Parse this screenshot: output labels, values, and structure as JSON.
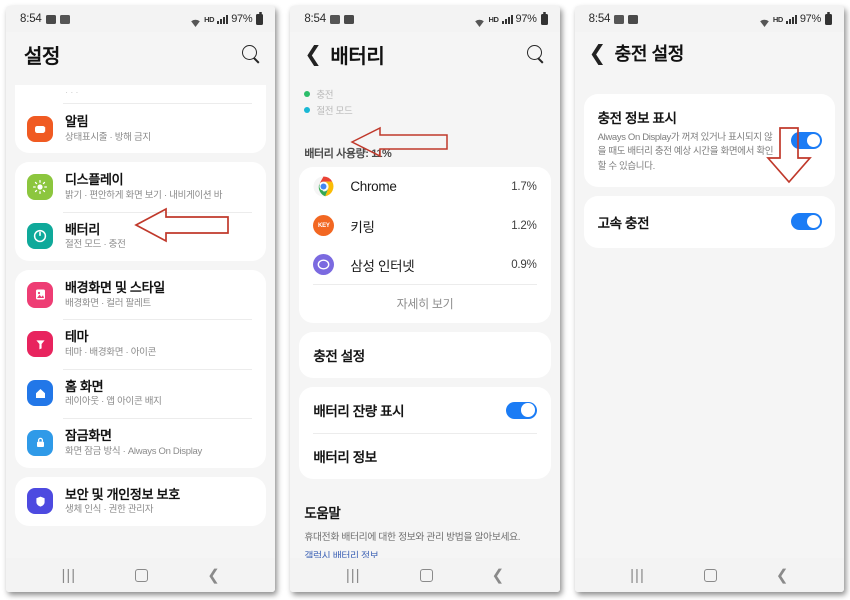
{
  "status_bar": {
    "time": "8:54",
    "battery_percent": "97%",
    "network_label": "HD",
    "icons": [
      "app-notification-icon",
      "app-notification-icon-2",
      "wifi-icon",
      "hd-voice-icon",
      "signal-icon",
      "battery-icon"
    ]
  },
  "panel_settings": {
    "title": "설정",
    "search_icon": "search-icon",
    "cut_off_row_subtitle": "· · ·",
    "groups": [
      {
        "items": [
          {
            "title": "알림",
            "subtitle": "상태표시줄 · 방해 금지",
            "icon": "notifications-icon",
            "color": "#f05a22"
          }
        ]
      },
      {
        "items": [
          {
            "title": "디스플레이",
            "subtitle": "밝기 · 편안하게 화면 보기 · 내비게이션 바",
            "icon": "display-icon",
            "color": "#8cc63e"
          },
          {
            "title": "배터리",
            "subtitle": "절전 모드 · 충전",
            "icon": "battery-icon",
            "color": "#0fa99a"
          }
        ]
      },
      {
        "items": [
          {
            "title": "배경화면 및 스타일",
            "subtitle": "배경화면 · 컬러 팔레트",
            "icon": "wallpaper-icon",
            "color": "#ee3d74"
          },
          {
            "title": "테마",
            "subtitle": "테마 · 배경화면 · 아이콘",
            "icon": "themes-icon",
            "color": "#e8245e"
          },
          {
            "title": "홈 화면",
            "subtitle": "레이아웃 · 앱 아이콘 배지",
            "icon": "home-screen-icon",
            "color": "#2277e8"
          },
          {
            "title": "잠금화면",
            "subtitle": "화면 잠금 방식 · Always On Display",
            "icon": "lock-screen-icon",
            "color": "#2f9ae8"
          }
        ]
      },
      {
        "items": [
          {
            "title": "보안 및 개인정보 보호",
            "subtitle": "생체 인식 · 권한 관리자",
            "icon": "security-icon",
            "color": "#4d4ae0"
          }
        ]
      }
    ]
  },
  "panel_battery": {
    "title": "배터리",
    "back_icon": "back-chevron-icon",
    "search_icon": "search-icon",
    "legend": [
      {
        "label": "충전",
        "color": "#2bbd6a"
      },
      {
        "label": "절전 모드",
        "color": "#19b8d4"
      }
    ],
    "usage_heading": "배터리 사용량: 11%",
    "apps": [
      {
        "name": "Chrome",
        "percent": "1.7%",
        "icon": "chrome-icon"
      },
      {
        "name": "키링",
        "percent": "1.2%",
        "icon": "keyring-icon"
      },
      {
        "name": "삼성 인터넷",
        "percent": "0.9%",
        "icon": "samsung-internet-icon"
      }
    ],
    "more_label": "자세히 보기",
    "charging_settings_label": "충전 설정",
    "battery_percent_row": {
      "label": "배터리 잔량 표시",
      "toggle_on": true
    },
    "battery_info_label": "배터리 정보",
    "help": {
      "title": "도움말",
      "text": "휴대전화 배터리에 대한 정보와 관리 방법을 알아보세요.",
      "link": "갤럭시 배터리 정보"
    }
  },
  "panel_charging": {
    "title": "충전 설정",
    "back_icon": "back-chevron-icon",
    "rows": [
      {
        "title": "충전 정보 표시",
        "desc": "Always On Display가 꺼져 있거나 표시되지 않을 때도 배터리 충전 예상 시간을 화면에서 확인할 수 있습니다.",
        "toggle_on": true
      },
      {
        "title": "고속 충전",
        "desc": "",
        "toggle_on": true
      }
    ]
  },
  "nav_bar": {
    "recents": "|||",
    "home": "home-square-icon",
    "back": "back-chevron-icon"
  },
  "annotations": {
    "color": "#c0392b",
    "arrow_1": "left-arrow pointing at 배터리 row",
    "arrow_2": "left-arrow pointing at 충전 설정 row",
    "arrow_3": "down-arrow pointing at 고속 충전 toggle"
  }
}
